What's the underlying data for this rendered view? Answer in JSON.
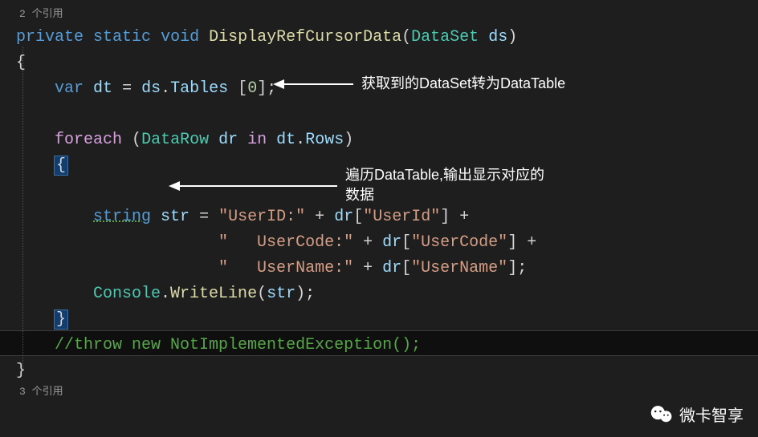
{
  "codelens_top": "2 个引用",
  "codelens_bottom": "3 个引用",
  "code": {
    "modifiers": {
      "private": "private",
      "static": "static",
      "void": "void"
    },
    "method_name": "DisplayRefCursorData",
    "param_type": "DataSet",
    "param_name": "ds",
    "var_kw": "var",
    "dt": "dt",
    "ds": "ds",
    "tables": "Tables",
    "index": "0",
    "foreach_kw": "foreach",
    "datarow": "DataRow",
    "dr": "dr",
    "in_kw": "in",
    "rows": "Rows",
    "string_kw": "string",
    "str": "str",
    "s_userid": "\"UserID:\"",
    "s_userid_key": "\"UserId\"",
    "s_usercode": "\"   UserCode:\"",
    "s_usercode_key": "\"UserCode\"",
    "s_username": "\"   UserName:\"",
    "s_username_key": "\"UserName\"",
    "console": "Console",
    "writeline": "WriteLine",
    "comment": "//throw new NotImplementedException();"
  },
  "annotations": {
    "a1": "获取到的DataSet转为DataTable",
    "a2_line1": "遍历DataTable,输出显示对应的",
    "a2_line2": "数据"
  },
  "watermark": "微卡智享"
}
